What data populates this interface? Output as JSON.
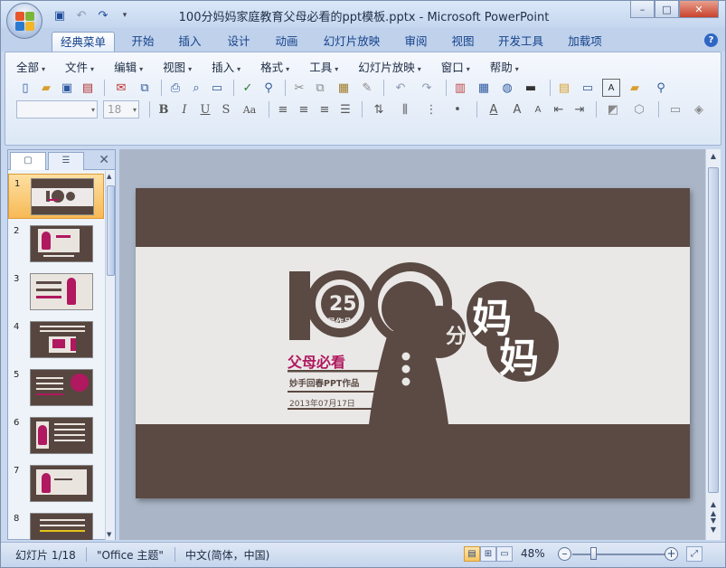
{
  "window": {
    "title": "100分妈妈家庭教育父母必看的ppt模板.pptx - Microsoft PowerPoint",
    "controls": {
      "minimize": "–",
      "maximize": "□",
      "close": "✕"
    }
  },
  "quick_access": [
    {
      "icon": "save-icon",
      "glyph": "💾"
    },
    {
      "icon": "undo-icon",
      "glyph": "↶"
    },
    {
      "icon": "redo-icon",
      "glyph": "↷"
    },
    {
      "icon": "customize-icon",
      "glyph": "▾"
    }
  ],
  "ribbon_tabs": [
    "经典菜单",
    "开始",
    "插入",
    "设计",
    "动画",
    "幻灯片放映",
    "审阅",
    "视图",
    "开发工具",
    "加载项"
  ],
  "active_tab": "经典菜单",
  "classic_menu": [
    "全部",
    "文件",
    "编辑",
    "视图",
    "插入",
    "格式",
    "工具",
    "幻灯片放映",
    "窗口",
    "帮助"
  ],
  "font_combo": {
    "font": "",
    "size": "18"
  },
  "left_panel": {
    "tabs": [
      "slides-tab",
      "outline-tab"
    ],
    "slide_numbers": [
      "1",
      "2",
      "3",
      "4",
      "5",
      "6",
      "7",
      "8"
    ],
    "selected": "1"
  },
  "slide": {
    "big_number": "100",
    "badge_number": "25",
    "badge_sub": "号作品",
    "fen": "分",
    "ma1": "妈",
    "ma2": "妈",
    "headline": "父母必看",
    "author": "妙手回春PPT作品",
    "date": "2013年07月17日",
    "colors": {
      "brown": "#5a4a43",
      "light": "#eae8e7",
      "magenta": "#b0185f"
    }
  },
  "status_bar": {
    "slide_info": "幻灯片 1/18",
    "theme": "\"Office 主题\"",
    "language": "中文(简体，中国)",
    "zoom": "48%"
  }
}
